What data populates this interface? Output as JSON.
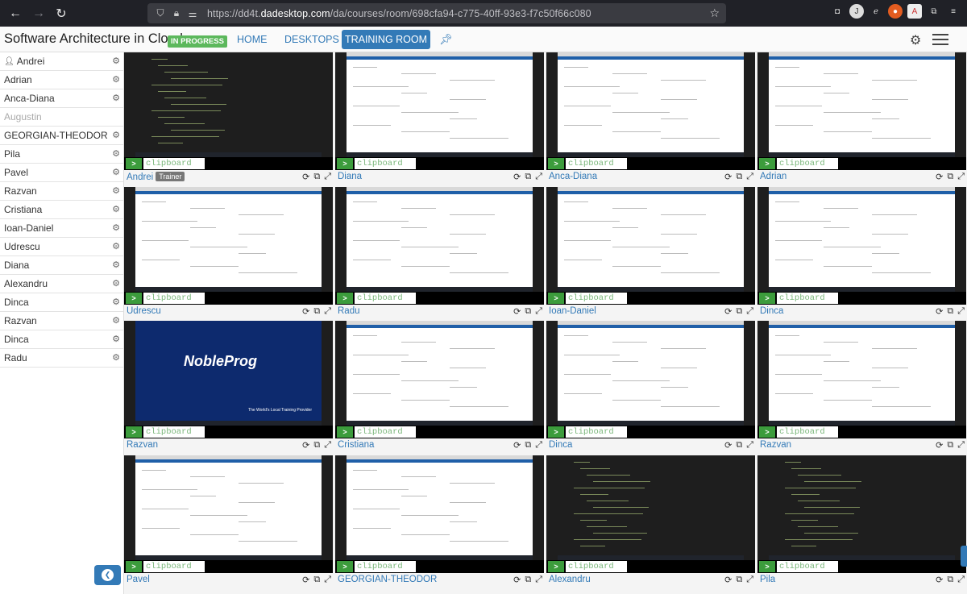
{
  "browser": {
    "url_prefix": "https://dd4t.",
    "url_domain": "dadesktop.com",
    "url_path": "/da/courses/room/698cfa94-c775-40ff-93e3-f7c50f66c080",
    "profile_initial": "J"
  },
  "header": {
    "title": "Software Architecture in Cloud",
    "status": "IN PROGRESS",
    "nav": {
      "home": "HOME",
      "desktops": "DESKTOPS",
      "training_room": "TRAINING ROOM"
    }
  },
  "sidebar": {
    "users": [
      {
        "name": "Andrei",
        "offline": false,
        "self": true
      },
      {
        "name": "Adrian",
        "offline": false
      },
      {
        "name": "Anca-Diana",
        "offline": false
      },
      {
        "name": "Augustin",
        "offline": true
      },
      {
        "name": "GEORGIAN-THEODOR",
        "offline": false
      },
      {
        "name": "Pila",
        "offline": false
      },
      {
        "name": "Pavel",
        "offline": false
      },
      {
        "name": "Razvan",
        "offline": false
      },
      {
        "name": "Cristiana",
        "offline": false
      },
      {
        "name": "Ioan-Daniel",
        "offline": false
      },
      {
        "name": "Udrescu",
        "offline": false
      },
      {
        "name": "Diana",
        "offline": false
      },
      {
        "name": "Alexandru",
        "offline": false
      },
      {
        "name": "Dinca",
        "offline": false
      },
      {
        "name": "Razvan",
        "offline": false
      },
      {
        "name": "Dinca",
        "offline": false
      },
      {
        "name": "Radu",
        "offline": false
      }
    ]
  },
  "tiles": {
    "clipboard_go": ">",
    "clipboard_placeholder": "clipboard",
    "trainer_label": "Trainer",
    "brand_text": "NobleProg",
    "brand_sub": "The World's Local Training Provider",
    "names": [
      "Andrei",
      "Diana",
      "Anca-Diana",
      "Adrian",
      "Udrescu",
      "Radu",
      "Ioan-Daniel",
      "Dinca",
      "Razvan",
      "Cristiana",
      "Dinca",
      "Razvan",
      "Pavel",
      "GEORGIAN-THEODOR",
      "Alexandru",
      "Pila"
    ],
    "screen_types": [
      "dark",
      "light",
      "light",
      "light",
      "light",
      "light",
      "light",
      "light",
      "blue",
      "light",
      "light",
      "light",
      "light",
      "light",
      "dark",
      "dark"
    ]
  },
  "colors": {
    "accent": "#337ab7",
    "success": "#5cb85c"
  }
}
